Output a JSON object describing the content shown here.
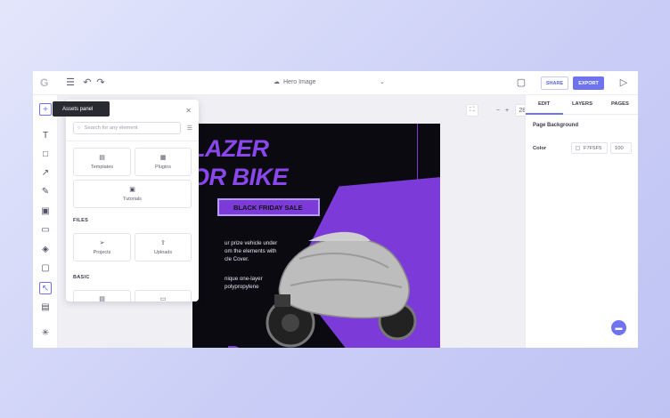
{
  "topbar": {
    "logo": "G",
    "doc_title": "Hero Image",
    "share_label": "SHARE",
    "export_label": "EXPORT"
  },
  "left_toolbar": {
    "tooltip": "Assets panel"
  },
  "assets_panel": {
    "search_placeholder": "Search for any element",
    "items_top": [
      "Templates",
      "Plugins",
      "Tutorials"
    ],
    "files_heading": "FILES",
    "files_items": [
      "Projects",
      "Uploads"
    ],
    "basic_heading": "BASIC"
  },
  "canvas": {
    "headline_line1": "LAZER",
    "headline_line2": "OR BIKE",
    "badge": "BLACK FRIDAY SALE",
    "body_line1": "ur prize vehicle under",
    "body_line2": "om the elements with",
    "body_line3": "cle Cover.",
    "body_line4": "nique one-layer",
    "body_line5": "polypropylene",
    "zoom": "28%"
  },
  "right_panel": {
    "tabs": [
      "EDIT",
      "LAYERS",
      "PAGES"
    ],
    "heading": "Page Background",
    "color_label": "Color",
    "color_value": "F7F5F5",
    "opacity_value": "100"
  },
  "colors": {
    "accent": "#6f73f0",
    "artboard_purple": "#7c3bd8",
    "artboard_bg": "#0b0a10"
  }
}
